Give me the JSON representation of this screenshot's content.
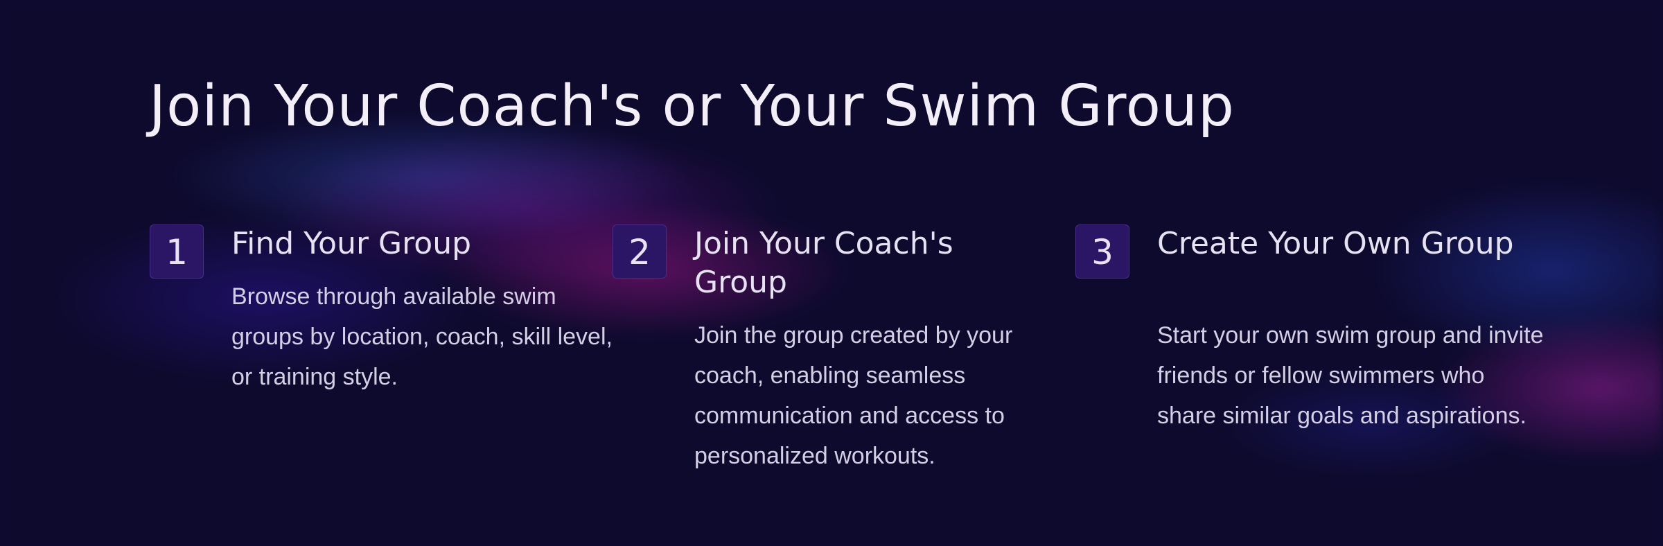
{
  "heading": "Join Your Coach's or Your Swim Group",
  "steps": [
    {
      "number": "1",
      "title": "Find Your Group",
      "description": "Browse through available swim groups by location, coach, skill level, or training style."
    },
    {
      "number": "2",
      "title": "Join Your Coach's Group",
      "description": "Join the group created by your coach, enabling seamless communication and access to personalized workouts."
    },
    {
      "number": "3",
      "title": "Create Your Own Group",
      "description": "Start your own swim group and invite friends or fellow swimmers who share similar goals and aspirations."
    }
  ],
  "colors": {
    "background": "#0e0a2e",
    "badge_fill": "#2a1664",
    "badge_border": "#4a2d8a",
    "heading_text": "#f3eef8",
    "body_text": "#d4cfe4"
  }
}
